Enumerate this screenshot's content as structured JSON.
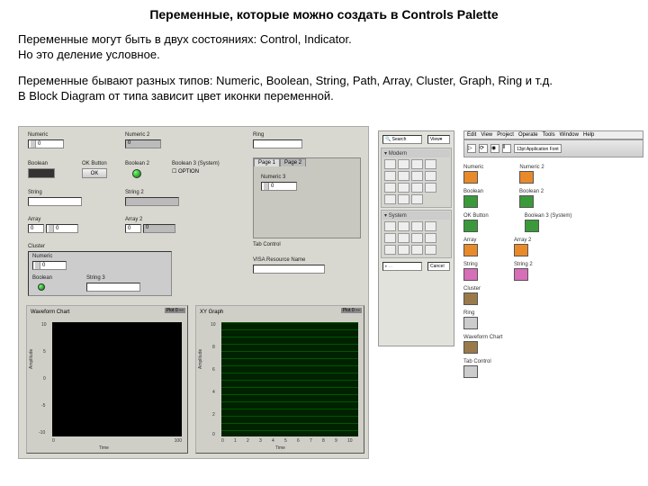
{
  "title": "Переменные, которые можно создать в Controls Palette",
  "para1a": "Переменные могут быть в двух состояниях: Control, Indicator.",
  "para1b": "Но это деление условное.",
  "para2a": "Переменные бывают разных типов: Numeric, Boolean, String, Path, Array, Cluster, Graph, Ring и т.д.",
  "para2b": "В Block Diagram от типа зависит цвет иконки переменной.",
  "left": {
    "numeric_lbl": "Numeric",
    "numeric_val": "0",
    "numeric2_lbl": "Numeric 2",
    "numeric2_val": "0",
    "ring_lbl": "Ring",
    "boolean_lbl": "Boolean",
    "okbtn_lbl": "OK Button",
    "okbtn_txt": "OK",
    "boolean2_lbl": "Boolean 2",
    "boolean3_lbl": "Boolean 3 (System)",
    "option_txt": "OPTION",
    "string_lbl": "String",
    "string2_lbl": "String 2",
    "array_lbl": "Array",
    "array_idx": "0",
    "array_val": "0",
    "array2_lbl": "Array 2",
    "array2_idx": "0",
    "array2_val": "0",
    "cluster_lbl": "Cluster",
    "cluster_num_lbl": "Numeric",
    "cluster_num_val": "0",
    "cluster_bool_lbl": "Boolean",
    "cluster_str_lbl": "String 3",
    "wave_lbl": "Waveform Chart",
    "wave_leg": "Plot 0",
    "wave_y_lbl": "Amplitude",
    "wave_x_lbl": "Time",
    "wave_y_ticks": [
      "10",
      "5",
      "0",
      "-5",
      "-10"
    ],
    "wave_x_ticks": [
      "0",
      "100"
    ],
    "xy_lbl": "XY Graph",
    "xy_leg": "Plot 0",
    "xy_y_lbl": "Amplitude",
    "xy_x_lbl": "Time",
    "xy_y_ticks": [
      "10",
      "8",
      "6",
      "4",
      "2",
      "0"
    ],
    "xy_x_ticks": [
      "0",
      "1",
      "2",
      "3",
      "4",
      "5",
      "6",
      "7",
      "8",
      "9",
      "10"
    ],
    "tab_lbl": "Tab Control",
    "tab_page1": "Page 1",
    "tab_page2": "Page 2",
    "tab_numeric3_lbl": "Numeric 3",
    "tab_numeric3_val": "0",
    "visa_lbl": "VISA Resource Name",
    "visa_ph": ""
  },
  "palette": {
    "search": "Search",
    "view": "View",
    "modern": "Modern",
    "system": "System",
    "cancel": "Cancel"
  },
  "bd": {
    "menu": [
      "Window",
      "Help"
    ],
    "menu_left": [
      "Edit",
      "View",
      "Project",
      "Operate",
      "Tools"
    ],
    "font": "13pt Application Font",
    "items": [
      {
        "lbl": "Numeric",
        "color": "ic-orange"
      },
      {
        "lbl": "Numeric 2",
        "color": "ic-orange"
      },
      {
        "lbl": "Boolean",
        "color": "ic-green"
      },
      {
        "lbl": "Boolean 2",
        "color": "ic-green"
      },
      {
        "lbl": "OK Button",
        "color": "ic-green"
      },
      {
        "lbl": "Boolean 3 (System)",
        "color": "ic-green"
      },
      {
        "lbl": "Array",
        "color": "ic-orange"
      },
      {
        "lbl": "Array 2",
        "color": "ic-orange"
      },
      {
        "lbl": "String",
        "color": "ic-pink"
      },
      {
        "lbl": "String 2",
        "color": "ic-pink"
      },
      {
        "lbl": "Cluster",
        "color": "ic-brown"
      },
      {
        "lbl": "Ring",
        "color": "ic-gray"
      },
      {
        "lbl": "Waveform Chart",
        "color": "ic-brown"
      },
      {
        "lbl": "Tab Control",
        "color": "ic-gray"
      }
    ]
  }
}
